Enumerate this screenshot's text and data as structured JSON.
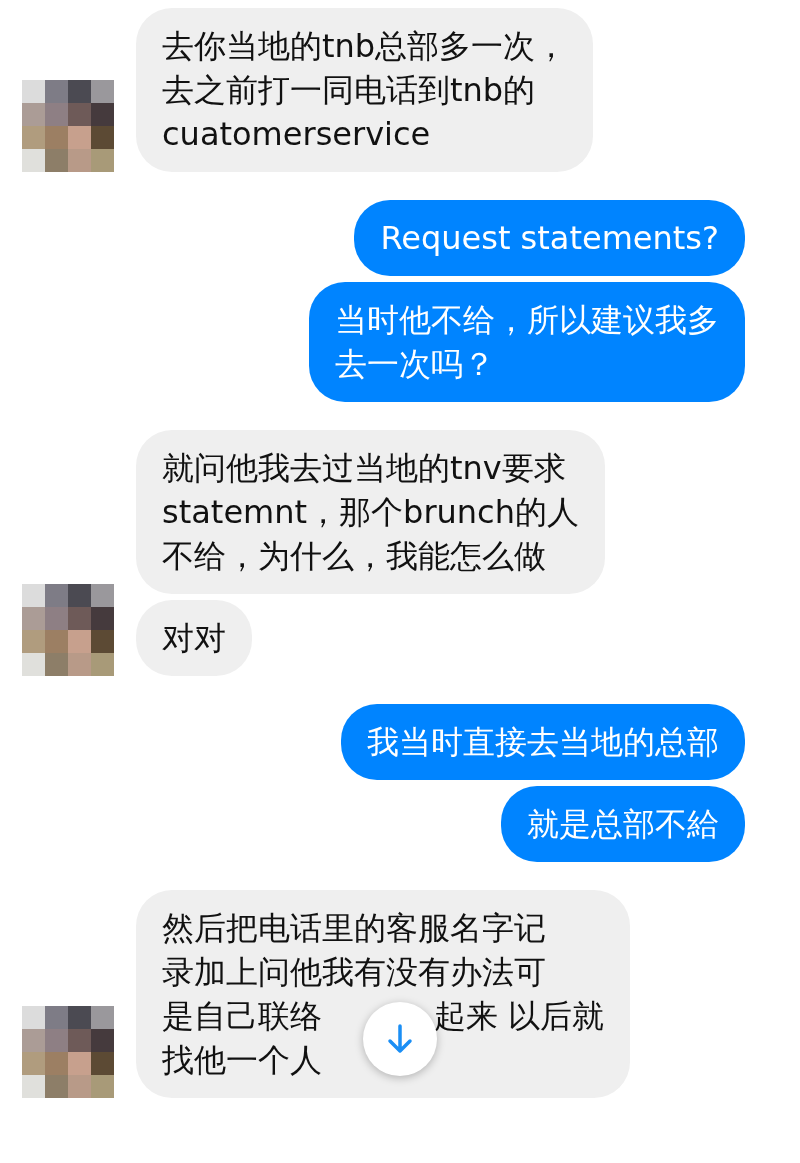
{
  "messages": [
    {
      "kind": "incoming",
      "bubbles": [
        {
          "lines": [
            [
              "去你当地的tnb总部多一次，"
            ],
            [
              "去之前打一同电话到tnb的"
            ],
            [
              "cuatomerservice"
            ]
          ]
        }
      ]
    },
    {
      "kind": "outgoing",
      "bubbles": [
        {
          "lines": [
            [
              "Request statements?"
            ]
          ]
        },
        {
          "lines": [
            [
              "当时他不给，所以建议我多"
            ],
            [
              "去一次吗？"
            ]
          ]
        }
      ]
    },
    {
      "kind": "incoming",
      "bubbles": [
        {
          "lines": [
            [
              "就问他我去过当地的tnv要求"
            ],
            [
              "statemnt，那个brunch的人"
            ],
            [
              "不给，为什么，我能怎么做"
            ]
          ]
        },
        {
          "lines": [
            [
              "对对"
            ]
          ]
        }
      ]
    },
    {
      "kind": "outgoing",
      "bubbles": [
        {
          "lines": [
            [
              "我当时直接去当地的总部"
            ]
          ]
        },
        {
          "lines": [
            [
              "就是总部不給"
            ]
          ]
        }
      ]
    },
    {
      "kind": "incoming",
      "bubbles": [
        {
          "lines": [
            [
              "然后把电话里的客服名字记"
            ],
            [
              "录加上问他我有没有办法可"
            ],
            [
              "是自己联络",
              "起来 以后就"
            ],
            [
              "找他一个人"
            ]
          ]
        }
      ]
    }
  ],
  "scroll_button": {
    "shown": true
  }
}
